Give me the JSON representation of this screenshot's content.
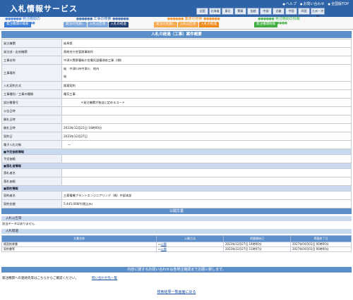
{
  "header": {
    "title": "入札情報サービス",
    "links": [
      "ヘルプ",
      "お問い合わせ",
      "全国版TOP"
    ],
    "regions": [
      "全国",
      "北海道",
      "東北",
      "関東",
      "信越",
      "中部",
      "近畿",
      "中国",
      "四国",
      "九州・沖縄"
    ]
  },
  "nav": {
    "groups": [
      {
        "label": "発注機関の検索",
        "color": "#3b7bd6",
        "buttons": [
          "発注機関の検索"
        ]
      },
      {
        "label": "工事の検索",
        "color": "#2f63a8",
        "buttons": [
          "発注の見通し",
          "入札公告等",
          "入札の経過"
        ]
      },
      {
        "label": "業務の検索",
        "color": "#f08a1a",
        "buttons": [
          "発注の見通し",
          "入札公告等",
          "入札の経過"
        ]
      },
      {
        "label": "発注機関の情報",
        "color": "#3fae3f",
        "buttons": [
          "発注機関情報"
        ]
      }
    ]
  },
  "page": {
    "heading": "入札の経過（工事）案件概要"
  },
  "detail": {
    "rows": [
      {
        "k": "発注機関",
        "v": "岐阜県"
      },
      {
        "k": "発注部・出先機関",
        "v": "県総合庁舎管理事務所"
      },
      {
        "k": "工事名称",
        "v": "中津川警察署新庁舎電気設備改修工事（I期）"
      },
      {
        "k": "工事場所",
        "v": "岐　中津川市中津川　地内\n\n岐"
      },
      {
        "k": "入札契約方式",
        "v": "随意契約"
      },
      {
        "k": "工事種別／工事の種類",
        "v": "電気工事"
      },
      {
        "k": "設計書番号",
        "v": "＊発注機関が独自に定めるコード"
      },
      {
        "k": "公告日時",
        "v": ""
      },
      {
        "k": "開札日時",
        "v": ""
      },
      {
        "k": "開札日時",
        "v": "2023年12月21日 10時00分"
      },
      {
        "k": "契約日",
        "v": "2023年12月27日"
      },
      {
        "k": "電子入札対象",
        "v": "ー"
      },
      {
        "section": "■予定価格情報"
      },
      {
        "k": "予定価格",
        "v": ""
      },
      {
        "section": "■落札者情報"
      },
      {
        "k": "落札者名",
        "v": ""
      },
      {
        "k": "落札価格",
        "v": ""
      },
      {
        "section": "■契約情報"
      },
      {
        "k": "契約者名",
        "v": "三菱電機プラントエンジニアリング（株）中部本部"
      },
      {
        "k": "契約金額",
        "v": "5,445,000円(税込み)"
      }
    ]
  },
  "docs": {
    "heading": "公開文書",
    "notice_title": "入札公告等",
    "notice_empty": "該当データはありません",
    "result_title": "入札経過",
    "columns": [
      "文書名称",
      "公開方法",
      "掲載開始日",
      "掲載終了日"
    ],
    "files": [
      {
        "name": "随契結果書",
        "method": "公開",
        "start": "2023年12月27日 14時00分",
        "end": "2027年04月01日 00時00分"
      },
      {
        "name": "契約書等",
        "method": "公開",
        "start": "2023年12月27日 11時07分",
        "end": "2027年04月01日 00時00分"
      }
    ]
  },
  "contact": {
    "heading": "内容に関するお問い合わせは各発注機関までお願い致します。",
    "text": "発注機関への連絡先等はこちらからご確認ください。",
    "link": "問い合わせ先一覧"
  },
  "footer": {
    "back_link": "検索結果一覧画面に戻る"
  }
}
